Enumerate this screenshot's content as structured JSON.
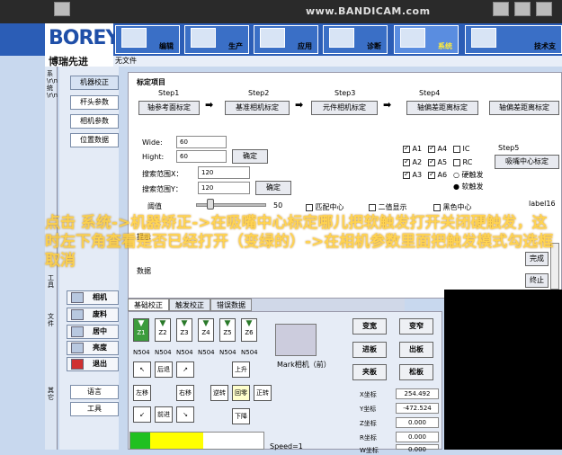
{
  "watermark": "www.BANDICAM.com",
  "logo": {
    "brand": "BOREY",
    "sub": "博瑞先进"
  },
  "toolbar": [
    {
      "label": "编辑",
      "icon": "edit-icon"
    },
    {
      "label": "生产",
      "icon": "production-icon"
    },
    {
      "label": "应用",
      "icon": "application-icon"
    },
    {
      "label": "诊断",
      "icon": "diagnose-icon"
    },
    {
      "label": "系统",
      "icon": "system-icon"
    },
    {
      "label": "技术支",
      "icon": "support-icon"
    }
  ],
  "file_label": "无文件",
  "left_tabs": {
    "system": "系\\r\\n统\\r\\n",
    "tools": "工具",
    "files": "文件",
    "other": "其它"
  },
  "left_buttons": [
    "机器校正",
    "杆头参数",
    "相机参数",
    "位置数据"
  ],
  "icon_buttons": [
    {
      "label": "相机",
      "icon": "camera-icon"
    },
    {
      "label": "废料",
      "icon": "waste-icon"
    },
    {
      "label": "居中",
      "icon": "center-icon"
    },
    {
      "label": "亮度",
      "icon": "brightness-icon"
    },
    {
      "label": "退出",
      "icon": "exit-icon"
    }
  ],
  "lang_button": "语言",
  "tools_button": "工具",
  "calibration": {
    "title": "标定项目",
    "steps": [
      {
        "step": "Step1",
        "button": "轴参考面标定"
      },
      {
        "step": "Step2",
        "button": "基准相机标定"
      },
      {
        "step": "Step3",
        "button": "元件相机标定"
      },
      {
        "step": "Step4",
        "button": "轴偏差距离标定"
      },
      {
        "step": "",
        "button": "轴偏差距离标定"
      }
    ],
    "step5": "Step5",
    "step5_button": "吸嘴中心标定",
    "wide_label": "Wide:",
    "wide_value": "60",
    "hight_label": "Hight:",
    "hight_value": "60",
    "confirm": "确定",
    "range_x_label": "搜索范围X：",
    "range_x_value": "120",
    "range_y_label": "搜索范围Y：",
    "range_y_value": "120",
    "confirm2": "确定",
    "threshold_label": "阈值",
    "threshold_value": "50",
    "match_center": "匹配中心",
    "binary_display": "二值显示",
    "black_center": "黑色中心",
    "label16": "label16",
    "axes": [
      {
        "name": "A1",
        "checked": true
      },
      {
        "name": "A4",
        "checked": true
      },
      {
        "name": "IC",
        "checked": false
      },
      {
        "name": "A2",
        "checked": true
      },
      {
        "name": "A5",
        "checked": true
      },
      {
        "name": "RC",
        "checked": false
      },
      {
        "name": "A3",
        "checked": true
      },
      {
        "name": "A6",
        "checked": true
      }
    ],
    "hard_trigger": "硬触发",
    "soft_trigger": "软触发",
    "hint_label": "提示",
    "data_label": "数据",
    "complete": "完成",
    "end": "终止"
  },
  "overlay_text": "点击 系统->机器矫正->在吸嘴中心标定哪儿把软触发打开关闭硬触发，这时左下角查看是否已经打开（变绿的）->在相机参数里面把触发模式勾选框取消",
  "bottom_tabs": [
    "基础校正",
    "触发校正",
    "错误数据"
  ],
  "nozzles": [
    "Z1",
    "Z2",
    "Z3",
    "Z4",
    "Z5",
    "Z6"
  ],
  "nozzle_types": [
    "N504",
    "N504",
    "N504",
    "N504",
    "N504",
    "N504"
  ],
  "mark_camera": "Mark相机（前）",
  "motion": {
    "back": "后退",
    "left": "左移",
    "right": "右移",
    "forward": "前进",
    "rotate_ccw": "逆转",
    "return_zero": "回零",
    "rotate_cw": "正转",
    "up": "上升",
    "down": "下降"
  },
  "right_buttons": [
    [
      "变宽",
      "变窄"
    ],
    [
      "进板",
      "出板"
    ],
    [
      "夹板",
      "松板"
    ]
  ],
  "coords": [
    {
      "label": "X坐标",
      "value": "254.492"
    },
    {
      "label": "Y坐标",
      "value": "-472.524"
    },
    {
      "label": "Z坐标",
      "value": "0.000"
    },
    {
      "label": "R坐标",
      "value": "0.000"
    },
    {
      "label": "W坐标",
      "value": "0.000"
    }
  ],
  "speed_label": "Speed=1",
  "progress": 0.55
}
